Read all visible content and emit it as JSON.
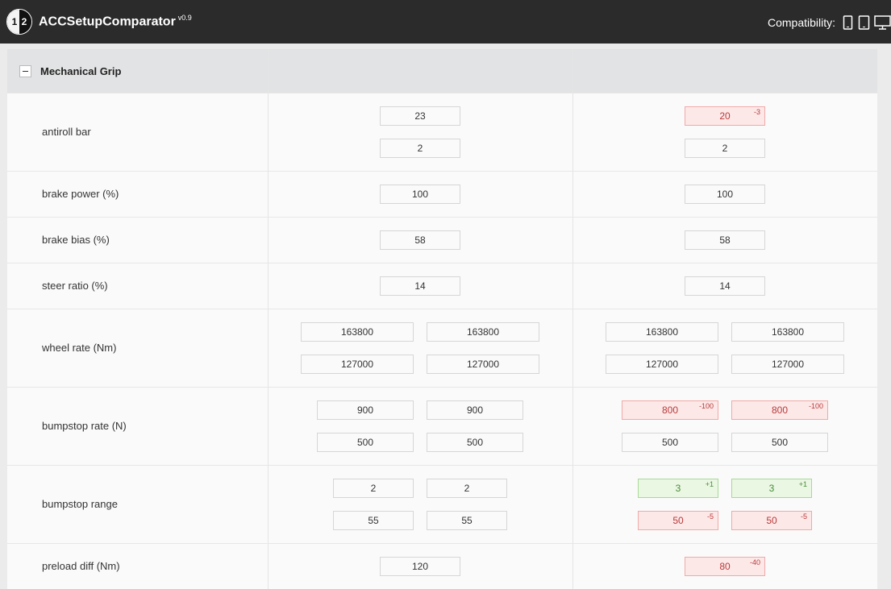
{
  "app": {
    "logo_left": "1",
    "logo_right": "2",
    "title": "ACCSetupComparator",
    "version": "v0.9"
  },
  "compatibility": {
    "label": "Compatibility:",
    "icons": [
      "phone-icon",
      "tablet-icon",
      "desktop-icon"
    ]
  },
  "section": {
    "title": "Mechanical Grip",
    "toggle_icon": "minus-icon"
  },
  "colors": {
    "topbar": "#2b2b2b",
    "header_bg": "#e2e3e4",
    "decrease_bg": "#fde8e8",
    "decrease_text": "#b83a3a",
    "increase_bg": "#eaf7e3",
    "increase_text": "#4a8a3a"
  },
  "rows": [
    {
      "label": "antiroll bar",
      "setup1": [
        [
          "23"
        ],
        [
          "2"
        ]
      ],
      "setup2": [
        [
          {
            "value": "20",
            "delta": "-3",
            "state": "decrease"
          }
        ],
        [
          {
            "value": "2"
          }
        ]
      ]
    },
    {
      "label": "brake power (%)",
      "setup1": [
        [
          "100"
        ]
      ],
      "setup2": [
        [
          {
            "value": "100"
          }
        ]
      ]
    },
    {
      "label": "brake bias (%)",
      "setup1": [
        [
          "58"
        ]
      ],
      "setup2": [
        [
          {
            "value": "58"
          }
        ]
      ]
    },
    {
      "label": "steer ratio (%)",
      "setup1": [
        [
          "14"
        ]
      ],
      "setup2": [
        [
          {
            "value": "14"
          }
        ]
      ]
    },
    {
      "label": "wheel rate (Nm)",
      "setup1": [
        [
          "163800",
          "163800"
        ],
        [
          "127000",
          "127000"
        ]
      ],
      "setup2": [
        [
          {
            "value": "163800"
          },
          {
            "value": "163800"
          }
        ],
        [
          {
            "value": "127000"
          },
          {
            "value": "127000"
          }
        ]
      ]
    },
    {
      "label": "bumpstop rate (N)",
      "setup1": [
        [
          "900",
          "900"
        ],
        [
          "500",
          "500"
        ]
      ],
      "setup2": [
        [
          {
            "value": "800",
            "delta": "-100",
            "state": "decrease"
          },
          {
            "value": "800",
            "delta": "-100",
            "state": "decrease"
          }
        ],
        [
          {
            "value": "500"
          },
          {
            "value": "500"
          }
        ]
      ]
    },
    {
      "label": "bumpstop range",
      "setup1": [
        [
          "2",
          "2"
        ],
        [
          "55",
          "55"
        ]
      ],
      "setup2": [
        [
          {
            "value": "3",
            "delta": "+1",
            "state": "increase"
          },
          {
            "value": "3",
            "delta": "+1",
            "state": "increase"
          }
        ],
        [
          {
            "value": "50",
            "delta": "-5",
            "state": "decrease"
          },
          {
            "value": "50",
            "delta": "-5",
            "state": "decrease"
          }
        ]
      ]
    },
    {
      "label": "preload diff (Nm)",
      "setup1": [
        [
          "120"
        ]
      ],
      "setup2": [
        [
          {
            "value": "80",
            "delta": "-40",
            "state": "decrease"
          }
        ]
      ]
    }
  ]
}
